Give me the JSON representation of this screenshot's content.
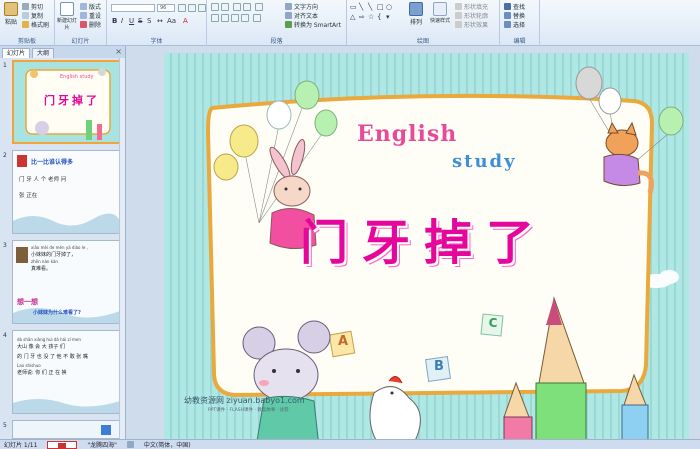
{
  "ribbon": {
    "clipboard": {
      "label": "剪贴板",
      "paste": "粘贴",
      "cut": "剪切",
      "copy": "复制",
      "format_painter": "格式刷"
    },
    "slides": {
      "label": "幻灯片",
      "new_slide": "新建幻灯片",
      "layout": "版式",
      "reset": "重设",
      "delete": "删除"
    },
    "font": {
      "label": "字体",
      "font_name": "",
      "font_size": "96"
    },
    "paragraph": {
      "label": "段落",
      "text_direction": "文字方向",
      "align_text": "对齐文本",
      "smartart": "转换为 SmartArt"
    },
    "drawing": {
      "label": "绘图",
      "arrange": "排列",
      "quick_styles": "快速样式",
      "shape_fill": "形状填充",
      "shape_outline": "形状轮廓",
      "shape_effects": "形状效果"
    },
    "editing": {
      "label": "编辑",
      "find": "查找",
      "replace": "替换",
      "select": "选择"
    }
  },
  "panel": {
    "tabs": [
      {
        "label": "幻灯片"
      },
      {
        "label": "大纲"
      }
    ],
    "thumbs": [
      {
        "num": "1",
        "title": "门牙掉了",
        "sub": "English study"
      },
      {
        "num": "2",
        "title": "比一比谁认得多",
        "line1": "门  牙  人  个  老师  问",
        "line2": "张  正在"
      },
      {
        "num": "3",
        "pinyin1": "xiǎo mèi de mén yá diào le ,",
        "line1": "小妹妹的门牙掉了，",
        "pinyin2": "zhēn nán kàn",
        "line2": "真难看。",
        "title": "想一想",
        "question": "小妹妹为什么难看了?"
      },
      {
        "num": "4",
        "pinyin1": "dà shān xiàng huì dà hái zi men",
        "line1": "大山 像 会 大 孩子 们",
        "line2": "的 门 牙 也 没 了 他 不 敢 张 嘴",
        "pinyin2": "Lao shishuo",
        "line3": "老师说: 你 们 正 在 换"
      },
      {
        "num": "5"
      }
    ]
  },
  "slide": {
    "title": "门牙掉了",
    "english": "English",
    "study": "study",
    "blocks": [
      "A",
      "B",
      "C"
    ],
    "watermark": "幼教资源网 ziyuan.babyo1.com",
    "watermark_sub": "PPT课件 · FLASH课件 · 教案故事 · 试卷"
  },
  "status": {
    "slide_info": "幻灯片 1/11",
    "theme": "\"龙腾四海\"",
    "language": "中文(简体，中国)"
  },
  "colors": {
    "title": "#e5079b",
    "english_e": "#e84a9a",
    "study": "#3f8fd6",
    "frame": "#e9a93c",
    "selection": "#f2a33a"
  }
}
